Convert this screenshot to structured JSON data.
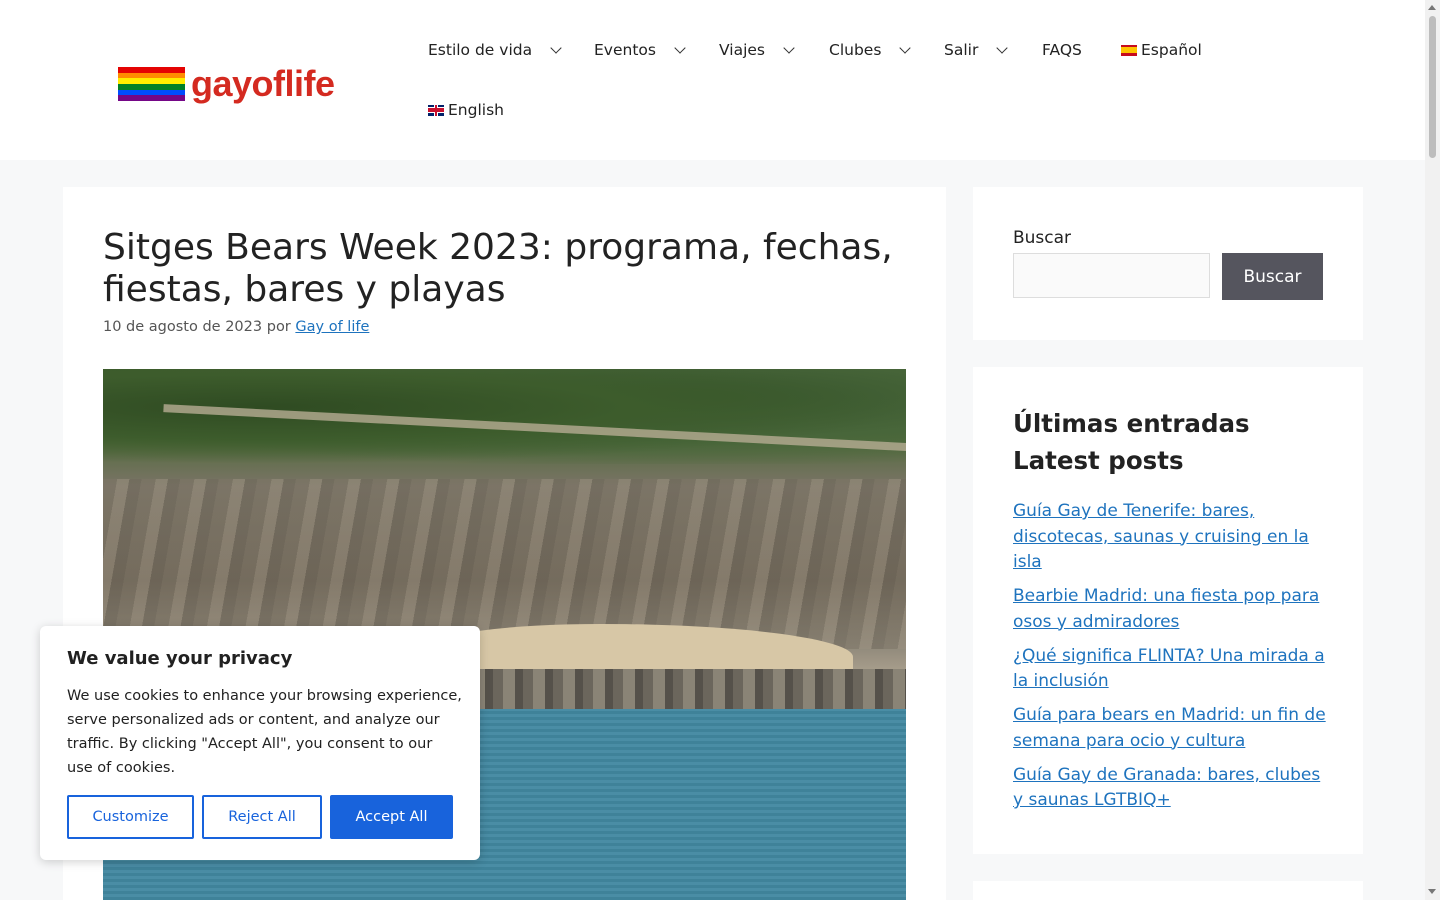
{
  "header": {
    "logo_text": "gayoflife",
    "rainbow": [
      "#e40303",
      "#ff8c00",
      "#ffed00",
      "#008026",
      "#004dff",
      "#750787"
    ],
    "nav": [
      {
        "label": "Estilo de vida",
        "dropdown": true
      },
      {
        "label": "Eventos",
        "dropdown": true
      },
      {
        "label": "Viajes",
        "dropdown": true
      },
      {
        "label": "Clubes",
        "dropdown": true
      },
      {
        "label": "Salir",
        "dropdown": true
      },
      {
        "label": "FAQS",
        "dropdown": false
      },
      {
        "label": "Español",
        "flag": "es-flag-icon"
      },
      {
        "label": "English",
        "flag": "gb-flag-icon"
      }
    ]
  },
  "article": {
    "title": "Sitges Bears Week 2023: programa, fechas, fiestas, bares y playas",
    "date": "10 de agosto de 2023",
    "by": "por",
    "author": "Gay of life"
  },
  "sidebar": {
    "search_label": "Buscar",
    "search_button": "Buscar",
    "posts_title_es": "Últimas entradas",
    "posts_title_en": "Latest posts",
    "posts": [
      "Guía Gay de Tenerife: bares, discotecas, saunas y cruising en la isla",
      "Bearbie Madrid: una fiesta pop para osos y admiradores",
      "¿Qué significa FLINTA? Una mirada a la inclusión",
      "Guía para bears en Madrid: un fin de semana para ocio y cultura",
      "Guía Gay de Granada: bares, clubes y saunas LGTBIQ+"
    ]
  },
  "cookie": {
    "title": "We value your privacy",
    "text": "We use cookies to enhance your browsing experience, serve personalized ads or content, and analyze our traffic. By clicking \"Accept All\", you consent to our use of cookies.",
    "customize": "Customize",
    "reject": "Reject All",
    "accept": "Accept All",
    "accent": "#1863dc"
  }
}
